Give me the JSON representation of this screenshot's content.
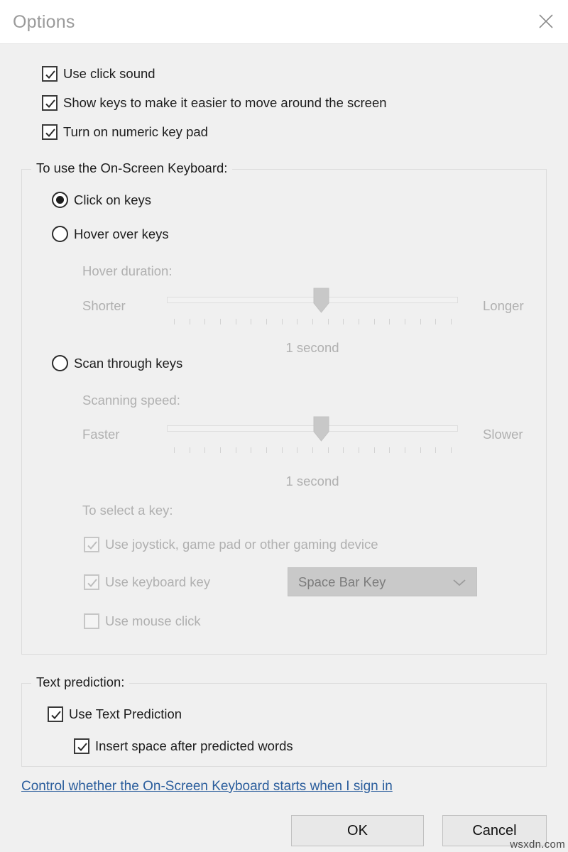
{
  "window": {
    "title": "Options",
    "close_label": "×",
    "close_icon": "close-icon"
  },
  "top_checkboxes": [
    {
      "label": "Use click sound",
      "checked": true,
      "enabled": true
    },
    {
      "label": "Show keys to make it easier to move around the screen",
      "checked": true,
      "enabled": true
    },
    {
      "label": "Turn on numeric key pad",
      "checked": true,
      "enabled": true
    }
  ],
  "keyboard_group": {
    "legend": "To use the On-Screen Keyboard:",
    "radios": [
      {
        "label": "Click on keys",
        "selected": true
      },
      {
        "label": "Hover over keys",
        "selected": false
      },
      {
        "label": "Scan through keys",
        "selected": false
      }
    ],
    "hover_slider": {
      "caption": "Hover duration:",
      "min_label": "Shorter",
      "max_label": "Longer",
      "value_label": "1 second",
      "position_percent": 53,
      "tick_count": 19,
      "enabled": false
    },
    "scan_slider": {
      "caption": "Scanning speed:",
      "min_label": "Faster",
      "max_label": "Slower",
      "value_label": "1 second",
      "position_percent": 53,
      "tick_count": 19,
      "enabled": false
    },
    "select_key": {
      "caption": "To select a key:",
      "options": [
        {
          "label": "Use joystick, game pad or other gaming device",
          "checked": true,
          "enabled": false
        },
        {
          "label": "Use keyboard key",
          "checked": true,
          "enabled": false
        },
        {
          "label": "Use mouse click",
          "checked": false,
          "enabled": false
        }
      ],
      "combo": {
        "value": "Space Bar Key",
        "arrow_icon": "chevron-down-icon",
        "enabled": false
      }
    }
  },
  "text_prediction_group": {
    "legend": "Text prediction:",
    "options": [
      {
        "label": "Use Text Prediction",
        "checked": true,
        "enabled": true
      },
      {
        "label": "Insert space after predicted words",
        "checked": true,
        "enabled": true
      }
    ]
  },
  "footer": {
    "link": "Control whether the On-Screen Keyboard starts when I sign in",
    "ok_label": "OK",
    "cancel_label": "Cancel"
  },
  "watermark": "wsxdn.com",
  "colors": {
    "body_bg": "#f0f0f0",
    "titlebar_bg": "#ffffff",
    "title_text": "#9a9a9a",
    "text": "#1d1d1d",
    "disabled_text": "#b0b0b0",
    "link": "#2a5d9c",
    "group_border": "#dcdcdc",
    "button_bg": "#e8e8e8",
    "combo_bg": "#c9c9c9"
  }
}
